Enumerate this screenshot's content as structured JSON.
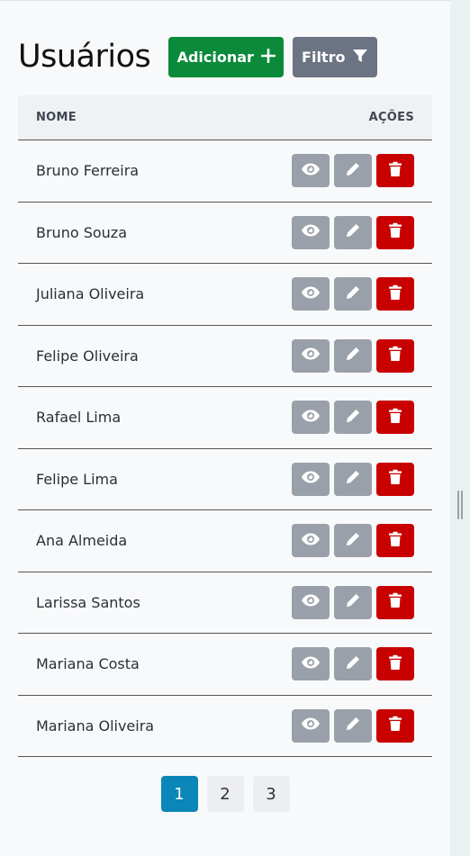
{
  "header": {
    "title": "Usuários",
    "add_label": "Adicionar",
    "filter_label": "Filtro"
  },
  "table": {
    "col_name": "NOME",
    "col_actions": "AÇÕES",
    "rows": [
      {
        "name": "Bruno Ferreira"
      },
      {
        "name": "Bruno Souza"
      },
      {
        "name": "Juliana Oliveira"
      },
      {
        "name": "Felipe Oliveira"
      },
      {
        "name": "Rafael Lima"
      },
      {
        "name": "Felipe Lima"
      },
      {
        "name": "Ana Almeida"
      },
      {
        "name": "Larissa Santos"
      },
      {
        "name": "Mariana Costa"
      },
      {
        "name": "Mariana Oliveira"
      }
    ]
  },
  "pagination": {
    "pages": [
      "1",
      "2",
      "3"
    ],
    "current": "1"
  },
  "icons": {
    "add": "plus-icon",
    "filter": "filter-icon",
    "view": "eye-icon",
    "edit": "pencil-icon",
    "delete": "trash-icon"
  },
  "colors": {
    "add_button": "#0a8a3a",
    "filter_button": "#6c7483",
    "view_edit_button": "#9aa0a9",
    "delete_button": "#c80000",
    "page_active": "#0a86b8"
  }
}
